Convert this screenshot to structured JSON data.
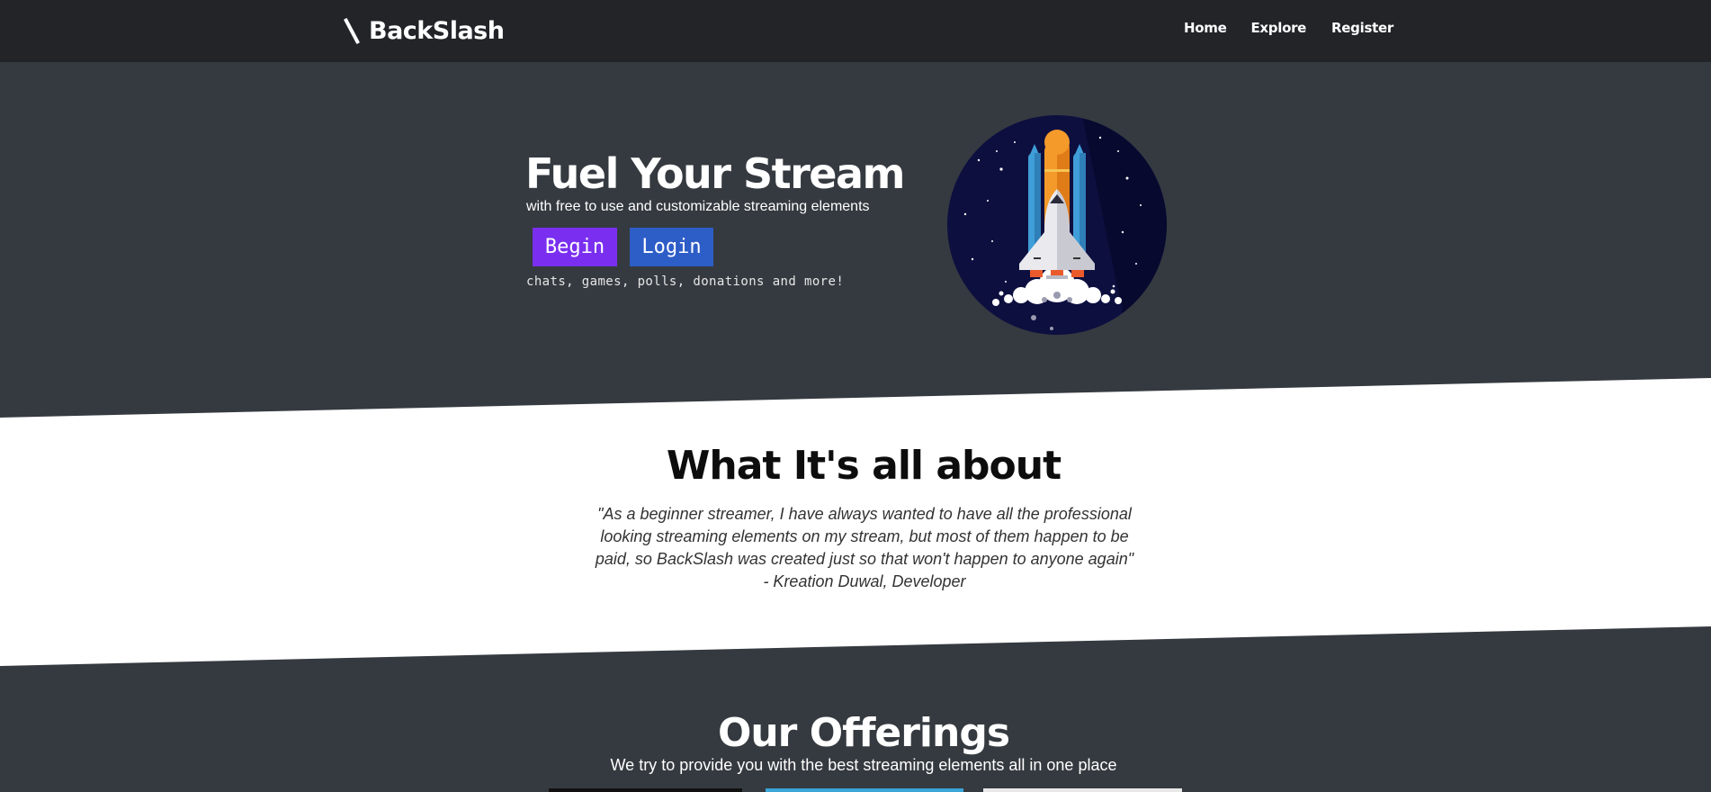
{
  "nav": {
    "brand_name": "BackSlash",
    "links": [
      "Home",
      "Explore",
      "Register"
    ]
  },
  "hero": {
    "title": "Fuel Your Stream",
    "subtitle": "with free to use and customizable streaming elements",
    "begin_label": "Begin",
    "login_label": "Login",
    "tagline": "chats, games, polls, donations and more!"
  },
  "about": {
    "title": "What It's all about",
    "quote": "\"As a beginner streamer, I have always wanted to have all the professional looking streaming elements on my stream, but most of them happen to be paid, so BackSlash was created just so that won't happen to anyone again\" - Kreation Duwal, Developer"
  },
  "offerings": {
    "title": "Our Offerings",
    "subtitle": "We try to provide you with the best streaming elements all in one place"
  },
  "colors": {
    "navbar_bg": "#222428",
    "page_bg": "#353a40",
    "begin_button": "#7a2ff0",
    "login_button": "#2d5dc7",
    "about_bg": "#ffffff"
  },
  "icons": {
    "brand": "backslash-icon",
    "hero_image": "rocket-launch-illustration"
  }
}
